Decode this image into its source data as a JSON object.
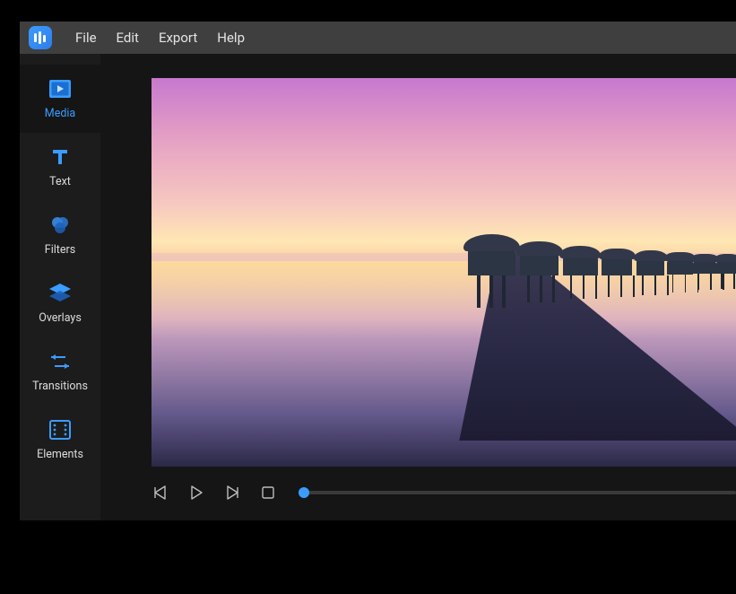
{
  "menu": {
    "file": "File",
    "edit": "Edit",
    "export": "Export",
    "help": "Help"
  },
  "sidebar": {
    "media": {
      "label": "Media"
    },
    "text": {
      "label": "Text"
    },
    "filters": {
      "label": "Filters"
    },
    "overlays": {
      "label": "Overlays"
    },
    "transitions": {
      "label": "Transitions"
    },
    "elements": {
      "label": "Elements"
    }
  },
  "colors": {
    "accent": "#3b9cff",
    "menubar": "#3f3f3f",
    "panel": "#1c1c1c"
  },
  "playback": {
    "position": 0
  }
}
